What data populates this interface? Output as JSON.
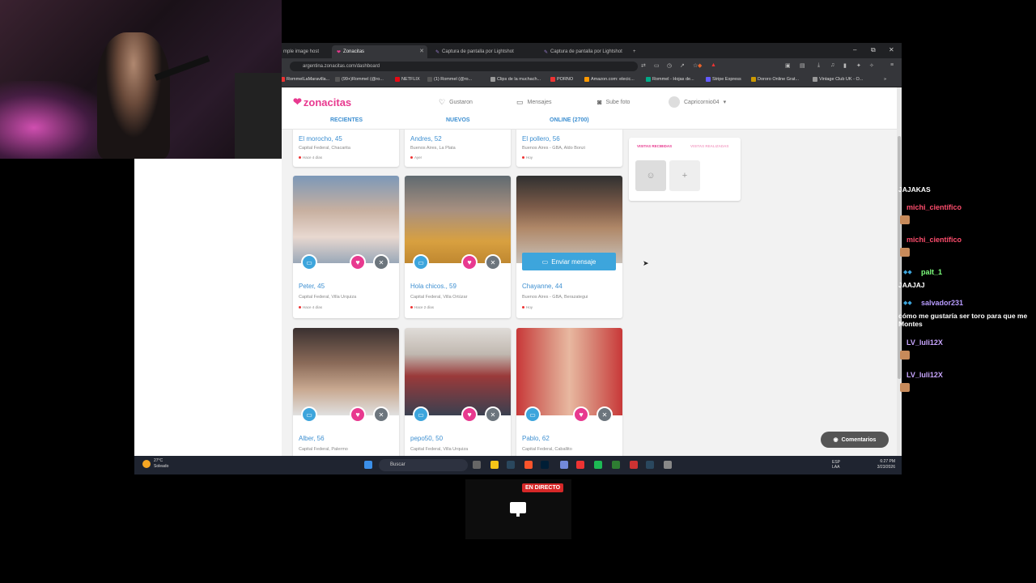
{
  "browser": {
    "tabs": [
      {
        "label": "mple image host",
        "active": false
      },
      {
        "label": "Zonacitas",
        "active": true
      },
      {
        "label": "Captura de pantalla por Lightshot",
        "active": false
      },
      {
        "label": "Captura de pantalla por Lightshot",
        "active": false
      }
    ],
    "new_tab": "+",
    "window_controls": [
      "–",
      "⧉",
      "✕"
    ],
    "url": "argentina.zonacitas.com/dashboard",
    "bookmarks": [
      {
        "label": "RommelLaMaravilla...",
        "color": "#e33"
      },
      {
        "label": "(99+)Rommel (@ro...",
        "color": "#333"
      },
      {
        "label": "NETFLIX",
        "color": "#e50914"
      },
      {
        "label": "(1) Rommel (@ro...",
        "color": "#333"
      },
      {
        "label": "Clips de la muchach...",
        "color": "#999"
      },
      {
        "label": "PORNO",
        "color": "#e33"
      },
      {
        "label": "Amazon.com: elecic...",
        "color": "#f90"
      },
      {
        "label": "Rommel - Hojas de...",
        "color": "#0a8"
      },
      {
        "label": "Stripe Express",
        "color": "#635bff"
      },
      {
        "label": "Dororo Online Grat...",
        "color": "#c90"
      },
      {
        "label": "Vintage Club UK - O...",
        "color": "#999"
      }
    ],
    "bookmarks_more": "»"
  },
  "site": {
    "logo_text": "zonacitas",
    "nav": {
      "likes": "Gustaron",
      "messages": "Mensajes",
      "upload": "Sube foto",
      "username": "Capricornio04"
    },
    "subtabs": [
      "RECIENTES",
      "NUEVOS",
      "ONLINE (2700)"
    ],
    "visits": {
      "received": "VISITAS RECIBIDAS",
      "made": "VISITAS REALIZADAS",
      "add": "+"
    },
    "comments_button": "Comentarios",
    "send_message_label": "Enviar mensaje",
    "profiles_top": [
      {
        "name": "El morocho, 45",
        "loc": "Capital Federal, Chacarita",
        "ago": "Hace 4 días"
      },
      {
        "name": "Andres, 52",
        "loc": "Buenos Aires, La Plata",
        "ago": "Ayer"
      },
      {
        "name": "El pollero, 56",
        "loc": "Buenos Aires - GBA, Aldo Bonzi",
        "ago": "Hoy"
      }
    ],
    "profiles_mid": [
      {
        "name": "Peter, 45",
        "loc": "Capital Federal, Villa Urquiza",
        "ago": "Hace 4 días",
        "photo": "#8a9cb0"
      },
      {
        "name": "Hola chicos., 59",
        "loc": "Capital Federal, Villa Ortúzar",
        "ago": "Hace 2 días",
        "photo": "#9a8a6a"
      },
      {
        "name": "Chayanne, 44",
        "loc": "Buenos Aires - GBA, Berazategui",
        "ago": "Hoy",
        "photo": "#6a5a50"
      }
    ],
    "profiles_bottom": [
      {
        "name": "Alber, 56",
        "loc": "Capital Federal, Palermo",
        "photo": "#7a6a60"
      },
      {
        "name": "pepo50, 50",
        "loc": "Capital Federal, Villa Urquiza",
        "photo": "#a04a4a"
      },
      {
        "name": "Pablo, 62",
        "loc": "Capital Federal, Caballito",
        "photo": "#c04040"
      }
    ]
  },
  "taskbar": {
    "weather_temp": "27°C",
    "weather_desc": "Soleado",
    "search": "Buscar",
    "lang_1": "ESP",
    "lang_2": "LAA",
    "time": "6:27 PM",
    "date": "3/23/2026"
  },
  "chat": [
    {
      "type": "msg",
      "text": "JAJAKAS"
    },
    {
      "type": "name",
      "name": "michi_científico",
      "color": "#ff4d6d"
    },
    {
      "type": "name",
      "name": "michi_científico",
      "color": "#ff4d6d"
    },
    {
      "type": "name",
      "name": "palt_1",
      "color": "#7dff7d"
    },
    {
      "type": "msg",
      "text": "JAAJAJ"
    },
    {
      "type": "name",
      "name": "salvador231",
      "color": "#b89cff"
    },
    {
      "type": "msg",
      "text": "cómo me gustaría ser toro para que me Montes"
    },
    {
      "type": "name",
      "name": "LV_luli12X",
      "color": "#c9a6ff"
    },
    {
      "type": "name",
      "name": "LV_luli12X",
      "color": "#c9a6ff"
    }
  ],
  "live": {
    "badge": "EN DIRECTO"
  },
  "colors": {
    "brand": "#e8398f",
    "accent": "#3da5dc"
  }
}
